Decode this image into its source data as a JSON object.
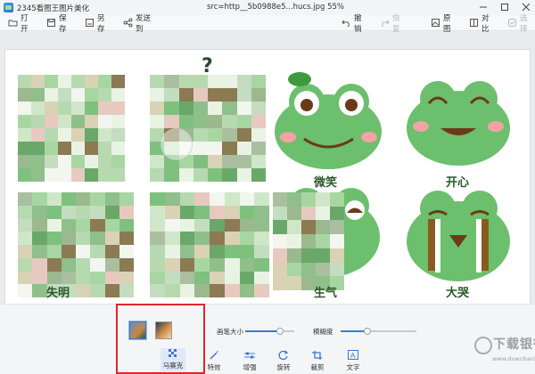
{
  "titlebar": {
    "app_title": "2345看图王图片美化",
    "file_info": "src=http__5b0988e5...hucs.jpg  55%"
  },
  "toolbar": {
    "open": "打开",
    "save": "保存",
    "save_as": "另存",
    "send_to": "发送到",
    "undo": "撤销",
    "redo": "恢复",
    "original": "原图",
    "compare": "对比",
    "select": "选择"
  },
  "image": {
    "labels": [
      "微笑",
      "开心",
      "失明",
      "生气",
      "大哭"
    ]
  },
  "bottom": {
    "brush_size_label": "画笔大小",
    "blur_label": "模糊度",
    "brush_size_value": 0.7,
    "blur_value": 0.35,
    "tools": [
      "马赛克",
      "特效",
      "增强",
      "旋转",
      "裁剪",
      "文字"
    ]
  },
  "watermark": {
    "main": "下载银行",
    "sub": "www.downbank.cn"
  },
  "colors": {
    "accent": "#3a79d8",
    "highlight": "#e2262a",
    "frog_green": "#6cbf6c"
  }
}
